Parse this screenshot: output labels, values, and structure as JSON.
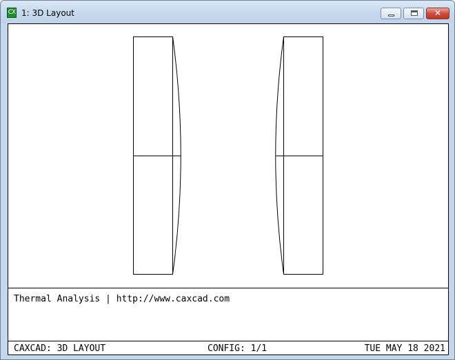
{
  "window": {
    "title": "1: 3D Layout",
    "icon": "cx-app-icon",
    "icon_text": "CX",
    "icon_color": "#1f8e2c"
  },
  "controls": {
    "minimize": "minimize-icon",
    "maximize": "maximize-icon",
    "close": "close-icon",
    "close_glyph": "✕"
  },
  "layout_view": {
    "lenses": [
      {
        "name": "left-lens",
        "curved_side": "right"
      },
      {
        "name": "right-lens",
        "curved_side": "left"
      }
    ]
  },
  "info": {
    "text": "Thermal Analysis | http://www.caxcad.com"
  },
  "status_bar": {
    "left": "CAXCAD: 3D LAYOUT",
    "center": "CONFIG: 1/1",
    "right": "TUE MAY 18 2021"
  }
}
